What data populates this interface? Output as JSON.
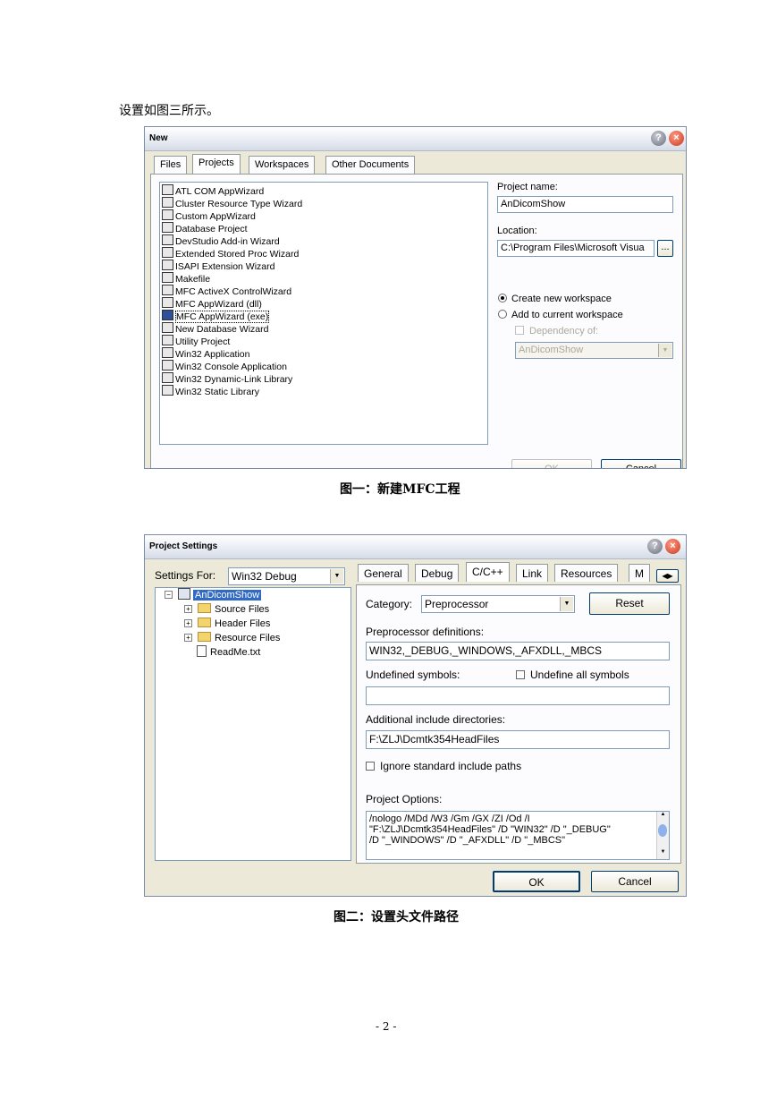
{
  "intro_text": "设置如图三所示。",
  "dialog1": {
    "title": "New",
    "tabs": [
      "Files",
      "Projects",
      "Workspaces",
      "Other Documents"
    ],
    "projects": [
      "ATL COM AppWizard",
      "Cluster Resource Type Wizard",
      "Custom AppWizard",
      "Database Project",
      "DevStudio Add-in Wizard",
      "Extended Stored Proc Wizard",
      "ISAPI Extension Wizard",
      "Makefile",
      "MFC ActiveX ControlWizard",
      "MFC AppWizard (dll)",
      "MFC AppWizard (exe)",
      "New Database Wizard",
      "Utility Project",
      "Win32 Application",
      "Win32 Console Application",
      "Win32 Dynamic-Link Library",
      "Win32 Static Library"
    ],
    "selected_project": "MFC AppWizard (exe)",
    "project_name_label": "Project name:",
    "project_name_value": "AnDicomShow",
    "location_label": "Location:",
    "location_value": "C:\\Program Files\\Microsoft Visua",
    "browse_label": "...",
    "radio_create": "Create new workspace",
    "radio_add": "Add to current workspace",
    "dependency_label": "Dependency of:",
    "dependency_value": "AnDicomShow",
    "ok_label": "OK",
    "cancel_label": "Cancel"
  },
  "caption1": "图一：新建MFC工程",
  "dialog2": {
    "title": "Project Settings",
    "settings_for_label": "Settings For:",
    "settings_for_value": "Win32 Debug",
    "tree": {
      "root": "AnDicomShow",
      "children": [
        "Source Files",
        "Header Files",
        "Resource Files",
        "ReadMe.txt"
      ]
    },
    "tabs": [
      "General",
      "Debug",
      "C/C++",
      "Link",
      "Resources",
      "M"
    ],
    "category_label": "Category:",
    "category_value": "Preprocessor",
    "reset_label": "Reset",
    "preproc_label": "Preprocessor definitions:",
    "preproc_value": "WIN32,_DEBUG,_WINDOWS,_AFXDLL,_MBCS",
    "undefined_label": "Undefined symbols:",
    "undefine_all_label": "Undefine all symbols",
    "undefined_value": "",
    "include_label": "Additional include directories:",
    "include_value": "F:\\ZLJ\\Dcmtk354HeadFiles",
    "ignore_label": "Ignore standard include paths",
    "options_label": "Project Options:",
    "options_lines": [
      "/nologo /MDd /W3 /Gm /GX /ZI /Od /I",
      "\"F:\\ZLJ\\Dcmtk354HeadFiles\" /D \"WIN32\" /D \"_DEBUG\"",
      "/D \"_WINDOWS\" /D \"_AFXDLL\" /D \"_MBCS\""
    ],
    "ok_label": "OK",
    "cancel_label": "Cancel"
  },
  "caption2": "图二：设置头文件路径",
  "page_number": "- 2 -"
}
